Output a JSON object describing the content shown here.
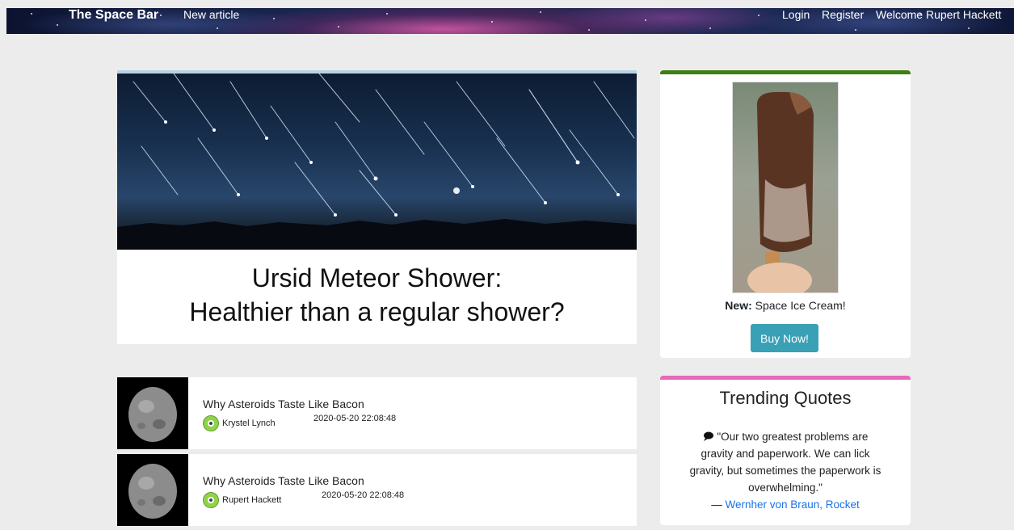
{
  "navbar": {
    "brand": "The Space Bar",
    "new_article": "New article",
    "login": "Login",
    "register": "Register",
    "welcome": "Welcome Rupert Hackett"
  },
  "hero": {
    "title_line1": "Ursid Meteor Shower:",
    "title_line2": "Healthier than a regular shower?"
  },
  "ad": {
    "caption_bold": "New:",
    "caption_text": "Space Ice Cream!",
    "button": "Buy Now!"
  },
  "articles": [
    {
      "title": "Why Asteroids Taste Like Bacon",
      "author": "Krystel Lynch",
      "date": "2020-05-20 22:08:48"
    },
    {
      "title": "Why Asteroids Taste Like Bacon",
      "author": "Rupert Hackett",
      "date": "2020-05-20 22:08:48"
    }
  ],
  "quotes": {
    "heading": "Trending Quotes",
    "text": "\"Our two greatest problems are gravity and paperwork. We can lick gravity, but sometimes the paperwork is overwhelming.\"",
    "dash": "—",
    "source": "Wernher von Braun, Rocket"
  },
  "colors": {
    "ad_border": "#3d7f12",
    "quotes_border": "#e56aba",
    "button": "#3aa0b5",
    "link": "#1a73e8"
  }
}
